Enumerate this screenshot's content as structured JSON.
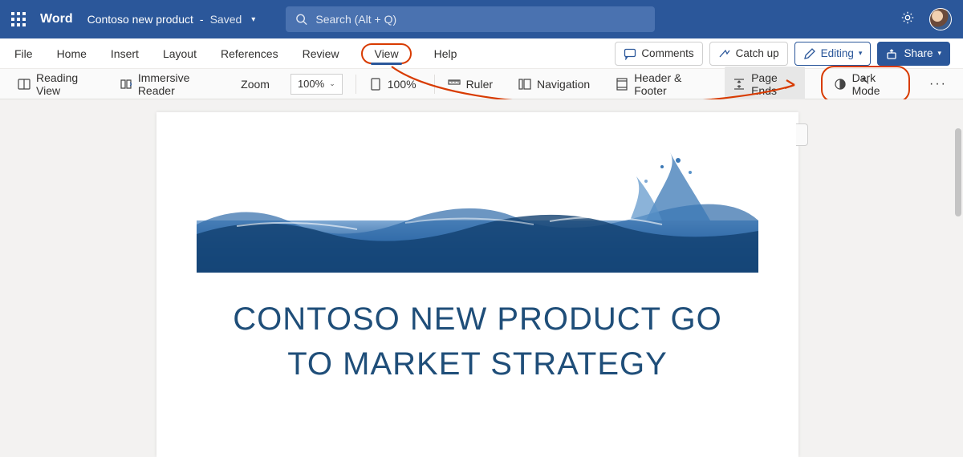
{
  "titlebar": {
    "app_name": "Word",
    "doc_name": "Contoso new product",
    "save_status": "Saved",
    "search_placeholder": "Search (Alt + Q)"
  },
  "ribbon": {
    "tabs": [
      "File",
      "Home",
      "Insert",
      "Layout",
      "References",
      "Review",
      "View",
      "Help"
    ],
    "active_tab": "View",
    "right": {
      "comments": "Comments",
      "catchup": "Catch up",
      "editing": "Editing",
      "share": "Share"
    }
  },
  "toolbar": {
    "reading_view": "Reading View",
    "immersive_reader": "Immersive Reader",
    "zoom_label": "Zoom",
    "zoom_value": "100%",
    "fit_100": "100%",
    "ruler": "Ruler",
    "navigation": "Navigation",
    "header_footer": "Header & Footer",
    "page_ends": "Page Ends",
    "dark_mode": "Dark Mode"
  },
  "document": {
    "title_line1": "CONTOSO NEW PRODUCT GO",
    "title_line2": "TO MARKET STRATEGY"
  },
  "colors": {
    "brand": "#2b579a",
    "highlight": "#d83b01",
    "title_text": "#1f4e79"
  }
}
